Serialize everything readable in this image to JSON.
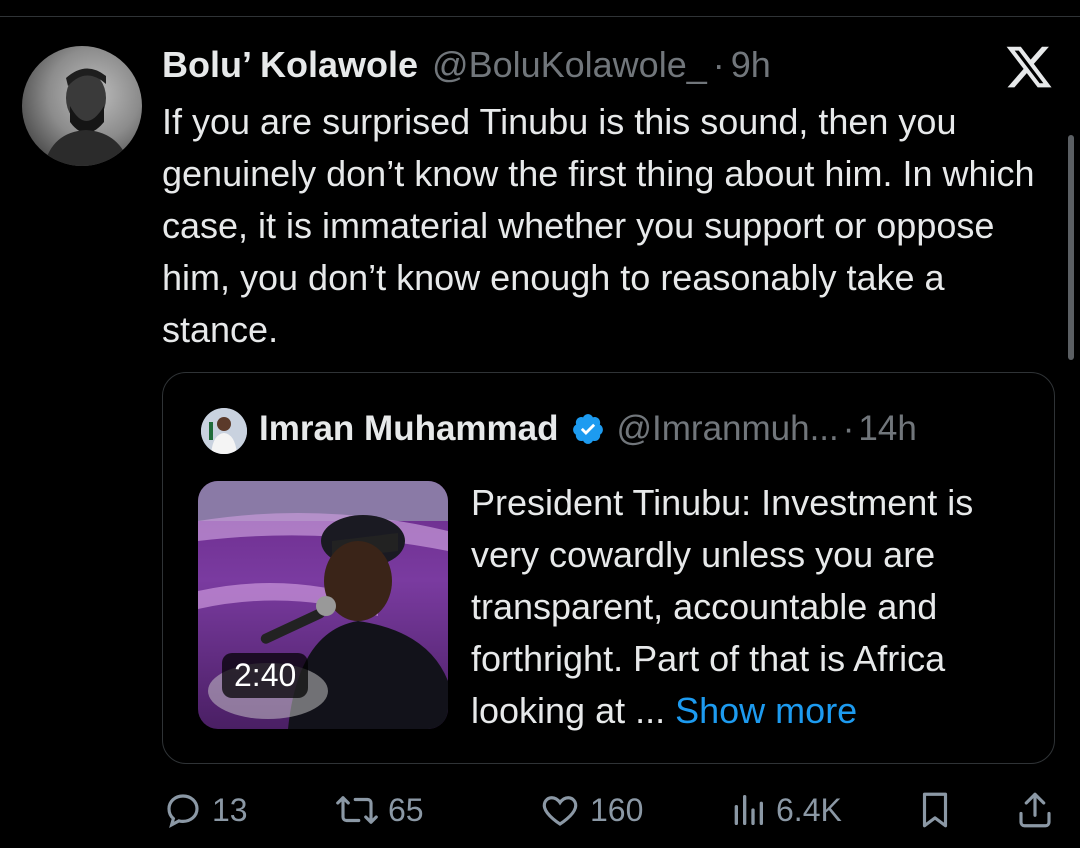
{
  "tweet": {
    "author_name": "Bolu’ Kolawole",
    "handle": "@BoluKolawole_",
    "separator": "·",
    "time": "9h",
    "text": "If you are surprised Tinubu is this sound, then you genuinely don’t know the first thing about him. In which case, it is immaterial whether you support or oppose him, you don’t know enough to reasonably take a stance."
  },
  "quoted_tweet": {
    "author_name": "Imran Muhammad",
    "handle": "@Imranmuh...",
    "separator": "·",
    "time": "14h",
    "video_duration": "2:40",
    "text": "President Tinubu: Investment is very cowardly unless you are transparent, accountable and forthright. Part of that is Africa looking at ... ",
    "show_more": "Show more"
  },
  "actions": {
    "replies": "13",
    "reposts": "65",
    "likes": "160",
    "views": "6.4K"
  },
  "colors": {
    "background": "#000000",
    "text": "#e7e9ea",
    "muted": "#71767b",
    "accent": "#1d9bf0",
    "border": "#2f3336"
  },
  "icons": [
    "x-logo-icon",
    "verified-badge-icon",
    "reply-icon",
    "repost-icon",
    "like-icon",
    "views-icon",
    "bookmark-icon",
    "share-icon"
  ]
}
